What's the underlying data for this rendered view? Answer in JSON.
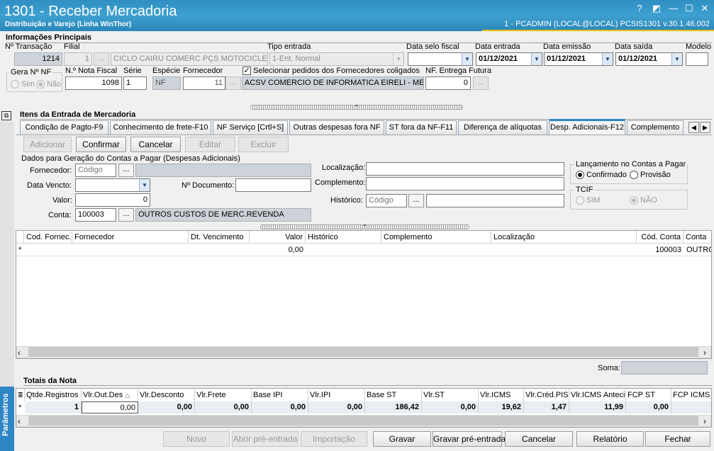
{
  "window": {
    "title": "1301 - Receber Mercadoria",
    "subtitle": "Distribuição e Varejo (Linha WinThor)",
    "status": "1 - PCADMIN (LOCAL@LOCAL)   PCSIS1301  v.30.1.46.002",
    "buttons": [
      "?",
      "◩",
      "—",
      "☐",
      "✕"
    ]
  },
  "principais": {
    "section_title": "Informações Principais",
    "transacao_label": "Nº Transação",
    "transacao_value": "1214",
    "filial_label": "Filial",
    "filial_value": "1",
    "filial_nome": "CICLO CAIRU COMERC PÇS MOTOCICLETAS L",
    "tipo_entrada_label": "Tipo entrada",
    "tipo_entrada_value": "1-Ent. Normal",
    "data_selo_label": "Data selo fiscal",
    "data_selo_value": "",
    "data_entrada_label": "Data entrada",
    "data_entrada_value": "01/12/2021",
    "data_emissao_label": "Data emissão",
    "data_emissao_value": "01/12/2021",
    "data_saida_label": "Data saída",
    "data_saida_value": "01/12/2021",
    "modelo_label": "Modelo",
    "modelo_value": "",
    "gera_nf_label": "Gera Nº NF",
    "sim_label": "Sim",
    "nao_label": "Não",
    "nota_fiscal_label": "N.º Nota Fiscal",
    "nota_fiscal_value": "1098",
    "serie_label": "Série",
    "serie_value": "1",
    "especie_label": "Espécie",
    "especie_value": "NF",
    "fornecedor_label": "Fornecedor",
    "fornecedor_value": "11",
    "fornecedor_nome": "ACSV COMERCIO DE INFORMATICA EIRELI - ME",
    "coligados_label": "Selecionar pedidos dos Fornecedores coligados",
    "nf_futura_label": "NF. Entrega Futura",
    "nf_futura_value": "0"
  },
  "itens": {
    "section_title": "Itens da Entrada de Mercadoria",
    "tabs": [
      {
        "label": "Condição de Pagto-F9"
      },
      {
        "label": "Conhecimento de frete-F10"
      },
      {
        "label": "NF Serviço [Crtl+S]"
      },
      {
        "label": "Outras despesas fora NF"
      },
      {
        "label": "ST fora da NF-F11"
      },
      {
        "label": "Diferença de alíquotas"
      },
      {
        "label": "Desp. Adicionais-F12"
      },
      {
        "label": "Complemento"
      }
    ],
    "toolbar": {
      "adicionar": "Adicionar",
      "confirmar": "Confirmar",
      "cancelar": "Cancelar",
      "editar": "Editar",
      "excluir": "Excluir"
    }
  },
  "despesas": {
    "group_title": "Dados para Geração do Contas a Pagar (Despesas Adicionais)",
    "fornecedor_label": "Fornecedor:",
    "fornecedor_placeholder": "Código",
    "data_vencto_label": "Data Vencto:",
    "documento_label": "Nº Documento:",
    "valor_label": "Valor:",
    "valor_value": "0",
    "conta_label": "Conta:",
    "conta_value": "100003",
    "conta_nome": "OUTROS CUSTOS DE MERC.REVENDA",
    "localizacao_label": "Localização:",
    "complemento_label": "Complemento:",
    "historico_label": "Histórico:",
    "historico_placeholder": "Código",
    "lancamento_title": "Lançamento no Contas a Pagar",
    "confirmado_label": "Confirmado",
    "provisao_label": "Provisão",
    "tcif_title": "TCIF",
    "tcif_sim": "SIM",
    "tcif_nao": "NÃO"
  },
  "grid": {
    "columns": [
      "Cod. Fornec.",
      "Fornecedor",
      "Dt. Vencimento",
      "Valor",
      "Histórico",
      "Complemento",
      "Localização",
      "Cód. Conta",
      "Conta"
    ],
    "row_marker": "*",
    "row": {
      "valor": "0,00",
      "cod_conta": "100003",
      "conta": "OUTRO"
    }
  },
  "soma": {
    "label": "Soma:",
    "value": ""
  },
  "totais": {
    "section_title": "Totais da Nota",
    "columns": [
      "Qtde.Registros",
      "Vlr.Out.Des",
      "Vlr.Desconto",
      "Vlr.Frete",
      "Base IPI",
      "Vlr.IPI",
      "Base ST",
      "Vlr.ST",
      "Vlr.ICMS",
      "Vlr.Créd.PIS",
      "Vlr.ICMS Anteci",
      "FCP ST",
      "FCP ICMS"
    ],
    "values": [
      "1",
      "0,00",
      "0,00",
      "0,00",
      "0,00",
      "0,00",
      "186,42",
      "0,00",
      "19,62",
      "1,47",
      "11,99",
      "0,00",
      ""
    ]
  },
  "sidebar_label": "Parâmetros",
  "footer": {
    "novo": "Novo",
    "abrir_pre_entrada": "Abrir pré-entrada",
    "importacao": "Importação",
    "gravar": "Gravar",
    "gravar_pre_entrada": "Gravar pré-entrada",
    "cancelar": "Cancelar",
    "relatorio": "Relatório",
    "fechar": "Fechar"
  }
}
